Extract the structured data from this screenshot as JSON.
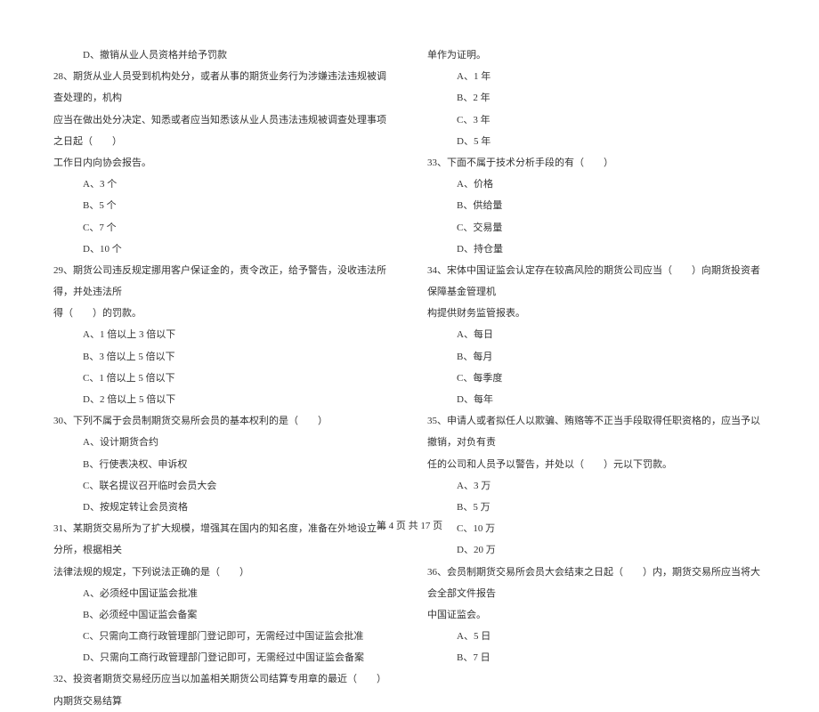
{
  "left": {
    "q27_d": "D、撤销从业人员资格并给予罚款",
    "q28_stem1": "28、期货从业人员受到机构处分，或者从事的期货业务行为涉嫌违法违规被调查处理的，机构",
    "q28_stem2": "应当在做出处分决定、知悉或者应当知悉该从业人员违法违规被调查处理事项之日起（　　）",
    "q28_stem3": "工作日内向协会报告。",
    "q28_a": "A、3 个",
    "q28_b": "B、5 个",
    "q28_c": "C、7 个",
    "q28_d": "D、10 个",
    "q29_stem1": "29、期货公司违反规定挪用客户保证金的，责令改正，给予警告，没收违法所得，并处违法所",
    "q29_stem2": "得（　　）的罚款。",
    "q29_a": "A、1 倍以上 3 倍以下",
    "q29_b": "B、3 倍以上 5 倍以下",
    "q29_c": "C、1 倍以上 5 倍以下",
    "q29_d": "D、2 倍以上 5 倍以下",
    "q30_stem": "30、下列不属于会员制期货交易所会员的基本权利的是（　　）",
    "q30_a": "A、设计期货合约",
    "q30_b": "B、行使表决权、申诉权",
    "q30_c": "C、联名提议召开临时会员大会",
    "q30_d": "D、按规定转让会员资格",
    "q31_stem1": "31、某期货交易所为了扩大规模，增强其在国内的知名度，准备在外地设立一分所，根据相关",
    "q31_stem2": "法律法规的规定，下列说法正确的是（　　）",
    "q31_a": "A、必须经中国证监会批准",
    "q31_b": "B、必须经中国证监会备案",
    "q31_c": "C、只需向工商行政管理部门登记即可，无需经过中国证监会批准",
    "q31_d": "D、只需向工商行政管理部门登记即可，无需经过中国证监会备案",
    "q32_stem1": "32、投资者期货交易经历应当以加盖相关期货公司结算专用章的最近（　　）内期货交易结算"
  },
  "right": {
    "q32_stem2": "单作为证明。",
    "q32_a": "A、1 年",
    "q32_b": "B、2 年",
    "q32_c": "C、3 年",
    "q32_d": "D、5 年",
    "q33_stem": "33、下面不属于技术分析手段的有（　　）",
    "q33_a": "A、价格",
    "q33_b": "B、供给量",
    "q33_c": "C、交易量",
    "q33_d": "D、持仓量",
    "q34_stem1": "34、宋体中国证监会认定存在较高风险的期货公司应当（　　）向期货投资者保障基金管理机",
    "q34_stem2": "构提供财务监管报表。",
    "q34_a": "A、每日",
    "q34_b": "B、每月",
    "q34_c": "C、每季度",
    "q34_d": "D、每年",
    "q35_stem1": "35、申请人或者拟任人以欺骗、贿赂等不正当手段取得任职资格的，应当予以撤销，对负有责",
    "q35_stem2": "任的公司和人员予以警告，并处以（　　）元以下罚款。",
    "q35_a": "A、3 万",
    "q35_b": "B、5 万",
    "q35_c": "C、10 万",
    "q35_d": "D、20 万",
    "q36_stem1": "36、会员制期货交易所会员大会结束之日起（　　）内，期货交易所应当将大会全部文件报告",
    "q36_stem2": "中国证监会。",
    "q36_a": "A、5 日",
    "q36_b": "B、7 日"
  },
  "footer": "第 4 页 共 17 页"
}
